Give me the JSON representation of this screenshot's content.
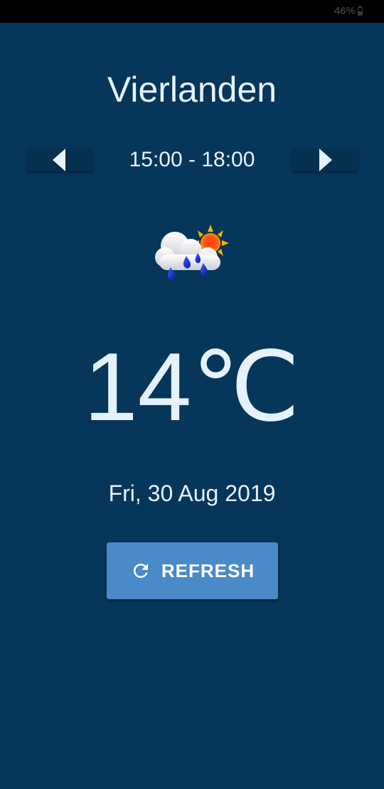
{
  "status_bar": {
    "battery_text": "46%",
    "battery_level": 0.46
  },
  "location": {
    "city": "Vierlanden"
  },
  "forecast": {
    "time_range": "15:00 - 18:00",
    "temperature": "14℃",
    "date": "Fri, 30 Aug 2019",
    "condition_icon": "cloud-rain-sun-icon"
  },
  "navigation": {
    "prev_icon": "chevron-left-icon",
    "next_icon": "chevron-right-icon"
  },
  "actions": {
    "refresh_label": "REFRESH",
    "refresh_icon": "refresh-icon"
  },
  "colors": {
    "background": "#06365a",
    "button_accent": "#4a8ac9",
    "text": "#e6f2fb"
  }
}
